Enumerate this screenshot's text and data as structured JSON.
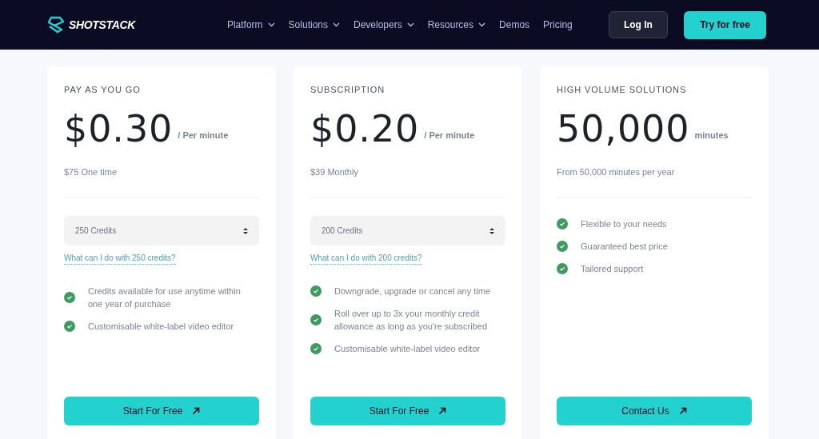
{
  "header": {
    "logo": "SHOTSTACK",
    "nav": [
      {
        "label": "Platform",
        "dropdown": true
      },
      {
        "label": "Solutions",
        "dropdown": true
      },
      {
        "label": "Developers",
        "dropdown": true
      },
      {
        "label": "Resources",
        "dropdown": true
      },
      {
        "label": "Demos",
        "dropdown": false
      },
      {
        "label": "Pricing",
        "dropdown": false
      }
    ],
    "login": "Log In",
    "cta": "Try for free"
  },
  "plans": [
    {
      "category": "PAY AS YOU GO",
      "price": "$0.30",
      "unit": "/ Per minute",
      "billing": "$75 One time",
      "select": "250 Credits",
      "link": "What can I do with 250 credits?",
      "features": [
        "Credits available for use anytime within one year of purchase",
        "Customisable white-label video editor"
      ],
      "button": "Start For Free"
    },
    {
      "category": "SUBSCRIPTION",
      "price": "$0.20",
      "unit": "/ Per minute",
      "billing": "$39 Monthly",
      "select": "200 Credits",
      "link": "What can I do with 200 credits?",
      "features": [
        "Downgrade, upgrade or cancel any time",
        "Roll over up to 3x your monthly credit allowance as long as you're subscribed",
        "Customisable white-label video editor"
      ],
      "button": "Start For Free"
    },
    {
      "category": "HIGH VOLUME SOLUTIONS",
      "price": "50,000",
      "unit": "minutes",
      "billing": "From 50,000 minutes per year",
      "features": [
        "Flexible to your needs",
        "Guaranteed best price",
        "Tailored support"
      ],
      "button": "Contact Us"
    }
  ]
}
